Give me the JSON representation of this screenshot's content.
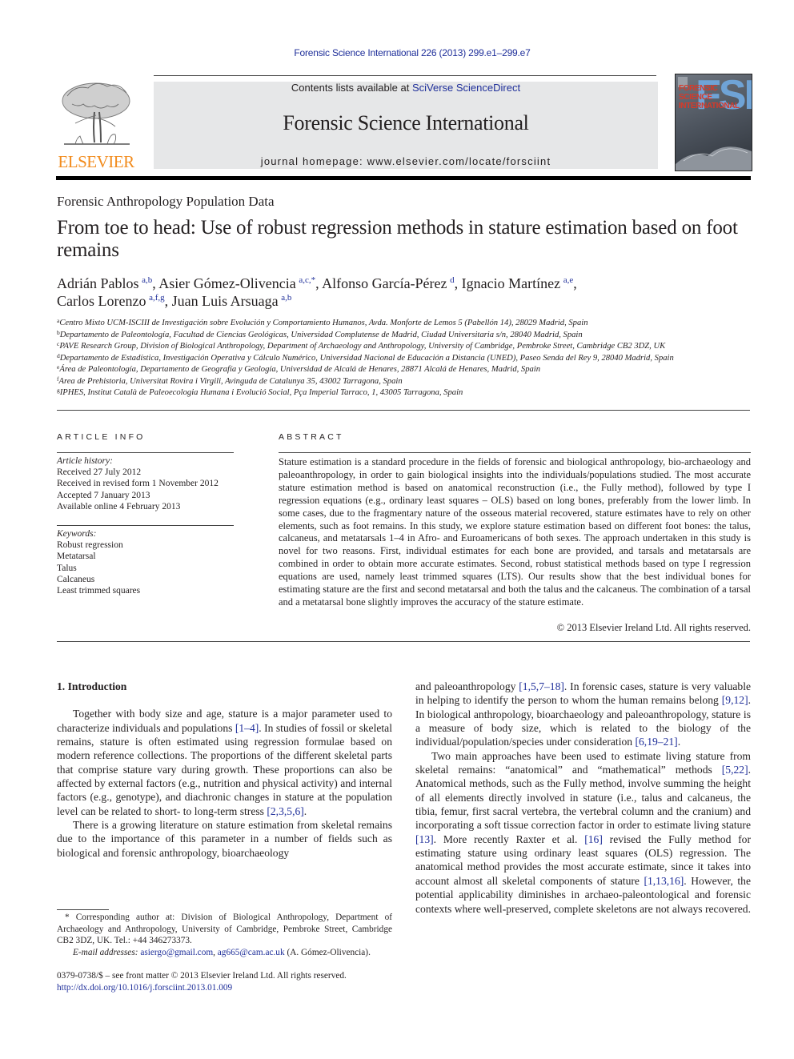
{
  "header": {
    "citation": "Forensic Science International 226 (2013) 299.e1–299.e7",
    "contents_prefix": "Contents lists available at ",
    "contents_link": "SciVerse ScienceDirect",
    "journal_name": "Forensic Science International",
    "homepage_prefix": "journal homepage: ",
    "homepage_url": "www.elsevier.com/locate/forsciint",
    "publisher_logo_text": "ELSEVIER",
    "cover": {
      "title_lines": [
        "FORENSIC",
        "SCIENCE",
        "INTERNATIONAL"
      ],
      "big_letters": "FSI"
    },
    "colors": {
      "link": "#1f2f9a",
      "publisher_orange": "#f28c1e",
      "banner_gray": "#e6e7e8",
      "cover_red": "#d63a2a",
      "cover_blue": "#6fa3d6"
    }
  },
  "article": {
    "section_label": "Forensic Anthropology Population Data",
    "title": "From toe to head: Use of robust regression methods in stature estimation based on foot remains",
    "authors": [
      {
        "name": "Adrián Pablos",
        "sup": "a,b"
      },
      {
        "name": "Asier Gómez-Olivencia",
        "sup": "a,c,*"
      },
      {
        "name": "Alfonso García-Pérez",
        "sup": "d"
      },
      {
        "name": "Ignacio Martínez",
        "sup": "a,e"
      },
      {
        "name": "Carlos Lorenzo",
        "sup": "a,f,g"
      },
      {
        "name": "Juan Luis Arsuaga",
        "sup": "a,b"
      }
    ],
    "affiliations": [
      {
        "key": "a",
        "text": "Centro Mixto UCM-ISCIII de Investigación sobre Evolución y Comportamiento Humanos, Avda. Monforte de Lemos 5 (Pabellón 14), 28029 Madrid, Spain"
      },
      {
        "key": "b",
        "text": "Departamento de Paleontología, Facultad de Ciencias Geológicas, Universidad Complutense de Madrid, Ciudad Universitaria s/n, 28040 Madrid, Spain"
      },
      {
        "key": "c",
        "text": "PAVE Research Group, Division of Biological Anthropology, Department of Archaeology and Anthropology, University of Cambridge, Pembroke Street, Cambridge CB2 3DZ, UK"
      },
      {
        "key": "d",
        "text": "Departamento de Estadística, Investigación Operativa y Cálculo Numérico, Universidad Nacional de Educación a Distancia (UNED), Paseo Senda del Rey 9, 28040 Madrid, Spain"
      },
      {
        "key": "e",
        "text": "Área de Paleontología, Departamento de Geografía y Geología, Universidad de Alcalá de Henares, 28871 Alcalá de Henares, Madrid, Spain"
      },
      {
        "key": "f",
        "text": "Area de Prehistoria, Universitat Rovira i Virgili, Avinguda de Catalunya 35, 43002 Tarragona, Spain"
      },
      {
        "key": "g",
        "text": "IPHES, Institut Català de Paleoecologia Humana i Evolució Social, Pça Imperial Tarraco, 1, 43005 Tarragona, Spain"
      }
    ]
  },
  "article_info": {
    "heading": "ARTICLE INFO",
    "history_label": "Article history:",
    "history": [
      "Received 27 July 2012",
      "Received in revised form 1 November 2012",
      "Accepted 7 January 2013",
      "Available online 4 February 2013"
    ],
    "keywords_label": "Keywords:",
    "keywords": [
      "Robust regression",
      "Metatarsal",
      "Talus",
      "Calcaneus",
      "Least trimmed squares"
    ]
  },
  "abstract": {
    "heading": "ABSTRACT",
    "text": "Stature estimation is a standard procedure in the fields of forensic and biological anthropology, bio-archaeology and paleoanthropology, in order to gain biological insights into the individuals/populations studied. The most accurate stature estimation method is based on anatomical reconstruction (i.e., the Fully method), followed by type I regression equations (e.g., ordinary least squares – OLS) based on long bones, preferably from the lower limb. In some cases, due to the fragmentary nature of the osseous material recovered, stature estimates have to rely on other elements, such as foot remains. In this study, we explore stature estimation based on different foot bones: the talus, calcaneus, and metatarsals 1–4 in Afro- and Euroamericans of both sexes. The approach undertaken in this study is novel for two reasons. First, individual estimates for each bone are provided, and tarsals and metatarsals are combined in order to obtain more accurate estimates. Second, robust statistical methods based on type I regression equations are used, namely least trimmed squares (LTS). Our results show that the best individual bones for estimating stature are the first and second metatarsal and both the talus and the calcaneus. The combination of a tarsal and a metatarsal bone slightly improves the accuracy of the stature estimate.",
    "copyright": "© 2013 Elsevier Ireland Ltd. All rights reserved."
  },
  "body": {
    "section_heading": "1. Introduction",
    "left_paragraphs": [
      [
        {
          "t": "Together with body size and age, stature is a major parameter used to characterize individuals and populations "
        },
        {
          "ref": "[1–4]"
        },
        {
          "t": ". In studies of fossil or skeletal remains, stature is often estimated using regression formulae based on modern reference collections. The proportions of the different skeletal parts that comprise stature vary during growth. These proportions can also be affected by external factors (e.g., nutrition and physical activity) and internal factors (e.g., genotype), and diachronic changes in stature at the population level can be related to short- to long-term stress "
        },
        {
          "ref": "[2,3,5,6]"
        },
        {
          "t": "."
        }
      ],
      [
        {
          "t": "There is a growing literature on stature estimation from skeletal remains due to the importance of this parameter in a number of fields such as biological and forensic anthropology, bioarchaeology"
        }
      ]
    ],
    "right_paragraphs": [
      [
        {
          "t": "and paleoanthropology "
        },
        {
          "ref": "[1,5,7–18]"
        },
        {
          "t": ". In forensic cases, stature is very valuable in helping to identify the person to whom the human remains belong "
        },
        {
          "ref": "[9,12]"
        },
        {
          "t": ". In biological anthropology, bioarchaeology and paleoanthropology, stature is a measure of body size, which is related to the biology of the individual/population/species under consideration "
        },
        {
          "ref": "[6,19–21]"
        },
        {
          "t": "."
        }
      ],
      [
        {
          "t": "Two main approaches have been used to estimate living stature from skeletal remains: “anatomical” and “mathematical” methods "
        },
        {
          "ref": "[5,22]"
        },
        {
          "t": ". Anatomical methods, such as the Fully method, involve summing the height of all elements directly involved in stature (i.e., talus and calcaneus, the tibia, femur, first sacral vertebra, the vertebral column and the cranium) and incorporating a soft tissue correction factor in order to estimate living stature "
        },
        {
          "ref": "[13]"
        },
        {
          "t": ". More recently Raxter et al. "
        },
        {
          "ref": "[16]"
        },
        {
          "t": " revised the Fully method for estimating stature using ordinary least squares (OLS) regression. The anatomical method provides the most accurate estimate, since it takes into account almost all skeletal components of stature "
        },
        {
          "ref": "[1,13,16]"
        },
        {
          "t": ". However, the potential applicability diminishes in archaeo-paleontological and forensic contexts where well-preserved, complete skeletons are not always recovered."
        }
      ]
    ]
  },
  "footnote": {
    "corresponding": "* Corresponding author at: Division of Biological Anthropology, Department of Archaeology and Anthropology, University of Cambridge, Pembroke Street, Cambridge CB2 3DZ, UK. Tel.: +44 346273373.",
    "email_label": "E-mail addresses:",
    "emails": [
      "asiergo@gmail.com",
      "ag665@cam.ac.uk"
    ],
    "email_owner": "(A. Gómez-Olivencia).",
    "front_matter": "0379-0738/$ – see front matter © 2013 Elsevier Ireland Ltd. All rights reserved.",
    "doi": "http://dx.doi.org/10.1016/j.forsciint.2013.01.009"
  }
}
